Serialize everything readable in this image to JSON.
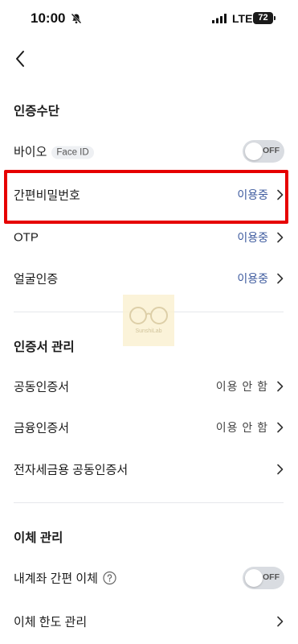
{
  "status_bar": {
    "time": "10:00",
    "network": "LTE",
    "battery": "72"
  },
  "sections": {
    "auth": {
      "title": "인증수단",
      "bio_label": "바이오",
      "bio_badge": "Face ID",
      "bio_toggle": "OFF",
      "bio_toggle_on": false,
      "simple_pw_label": "간편비밀번호",
      "simple_pw_status": "이용중",
      "otp_label": "OTP",
      "otp_status": "이용중",
      "face_label": "얼굴인증",
      "face_status": "이용중"
    },
    "cert": {
      "title": "인증서 관리",
      "joint_label": "공동인증서",
      "joint_status": "이용 안 함",
      "finance_label": "금융인증서",
      "finance_status": "이용 안 함",
      "tax_label": "전자세금용 공동인증서"
    },
    "transfer": {
      "title": "이체 관리",
      "own_transfer_label": "내계좌 간편 이체",
      "own_transfer_toggle": "OFF",
      "own_transfer_toggle_on": false,
      "limit_label": "이체 한도 관리"
    }
  },
  "watermark": {
    "text": "SunshiLab"
  },
  "colors": {
    "active_status": "#3d5a9e",
    "highlight": "#e60000",
    "toggle_off": "#d9dce1"
  }
}
